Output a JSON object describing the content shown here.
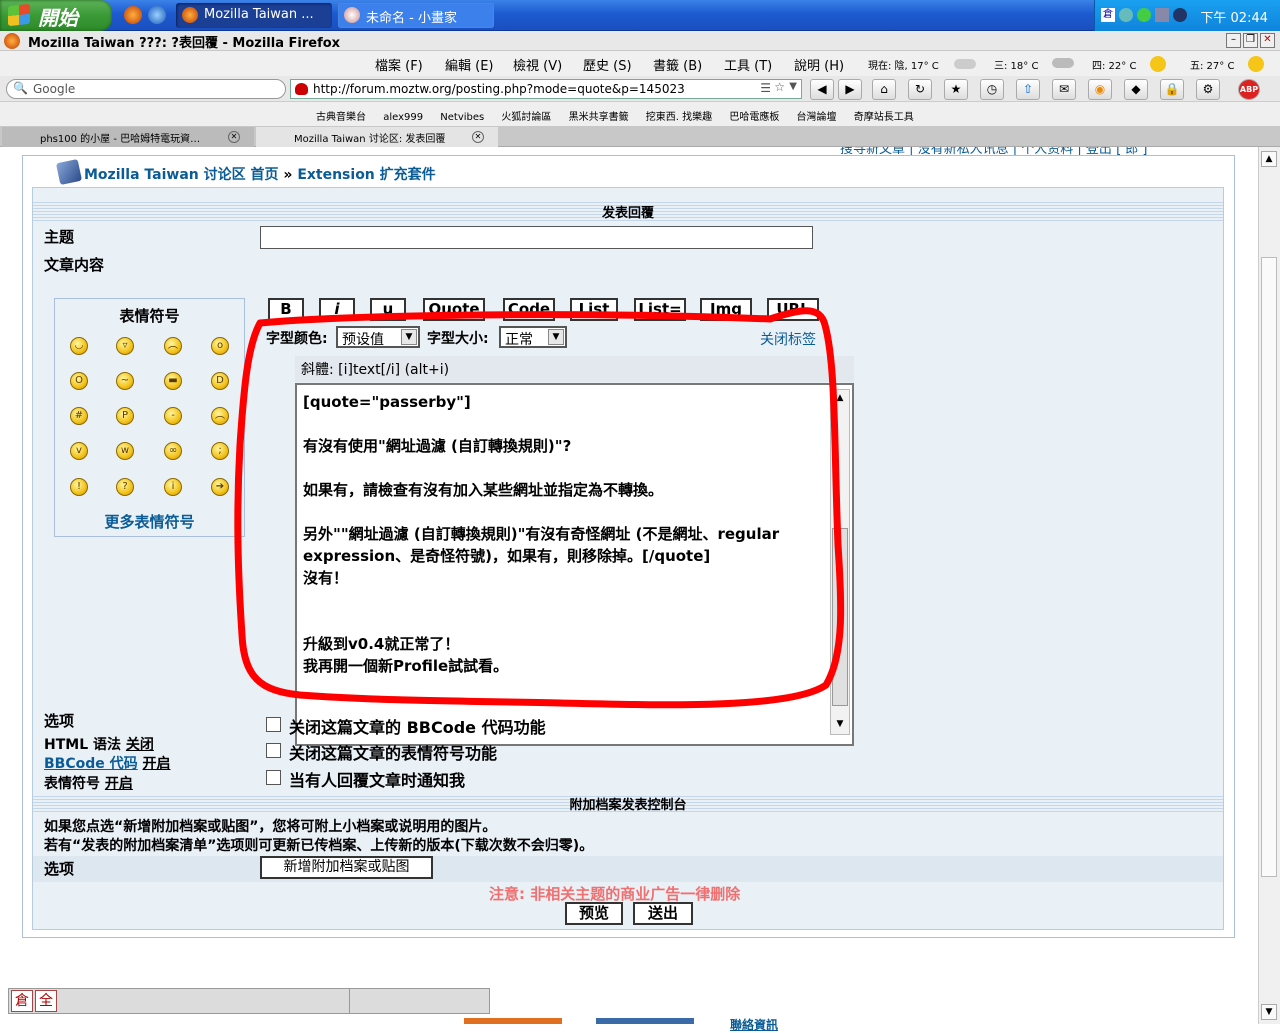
{
  "taskbar": {
    "start_label": "開始",
    "tasks": [
      {
        "label": "Mozilla Taiwan ...",
        "active": true
      },
      {
        "label": "未命名 - 小畫家",
        "active": false
      }
    ],
    "clock": "下午 02:44"
  },
  "window": {
    "title": "Mozilla Taiwan ???: ?表回覆 - Mozilla Firefox",
    "min": "–",
    "max": "❐",
    "close": "✕"
  },
  "menu": {
    "items": [
      "檔案 (F)",
      "編輯 (E)",
      "檢視 (V)",
      "歷史 (S)",
      "書籤 (B)",
      "工具 (T)",
      "說明 (H)"
    ],
    "weather": [
      "現在: 陰, 17° C",
      "三: 18° C",
      "四: 22° C",
      "五: 27° C"
    ]
  },
  "nav": {
    "search_placeholder": "Google",
    "url": "http://forum.moztw.org/posting.php?mode=quote&p=145023"
  },
  "bookmarks": [
    "古典音樂台",
    "alex999",
    "Netvibes",
    "火狐討論區",
    "黑米共享書籤",
    "挖東西. 找樂趣",
    "巴哈電應板",
    "台灣論壇",
    "奇摩站長工具"
  ],
  "tabs": [
    {
      "label": "phs100 的小屋 - 巴哈姆特電玩資…"
    },
    {
      "label": "Mozilla Taiwan 讨论区: 发表回覆"
    }
  ],
  "forum": {
    "toplinks": "搜寻新文章 | 没有新私人讯息 | 个人资料 | 登出 [ 郎 ]",
    "breadcrumb_home": "Mozilla Taiwan 讨论区 首页",
    "breadcrumb_sep": "»",
    "breadcrumb_section": "Extension 扩充套件",
    "post_header": "发表回覆",
    "subject_label": "主题",
    "content_label": "文章内容",
    "bbcode_buttons": [
      "B",
      "i",
      "u",
      "Quote",
      "Code",
      "List",
      "List=",
      "Img",
      "URL"
    ],
    "font_color_label": "字型颜色:",
    "font_color_value": "预设值",
    "font_size_label": "字型大小:",
    "font_size_value": "正常",
    "close_tags": "关闭标签",
    "smilies_title": "表情符号",
    "more_smilies": "更多表情符号",
    "help_line": "斜體: [i]text[/i]  (alt+i)",
    "message": "[quote=\"passerby\"]\n\n有沒有使用\"網址過濾 (自訂轉換規則)\"?\n\n如果有，請檢查有沒有加入某些網址並指定為不轉換。\n\n另外\"\"網址過濾 (自訂轉換規則)\"有沒有奇怪網址 (不是網址、regular expression、是奇怪符號)，如果有，則移除掉。[/quote]\n沒有！\n\n\n升級到v0.4就正常了！\n我再開一個新Profile試試看。",
    "options_label": "选项",
    "html_label": "HTML 语法",
    "html_value": "关闭",
    "bbcode_label": "BBCode 代码",
    "bbcode_value": "开启",
    "smilies_label": "表情符号",
    "smilies_value": "开启",
    "opt1": "关闭这篇文章的 BBCode 代码功能",
    "opt2": "关闭这篇文章的表情符号功能",
    "opt3": "当有人回覆文章时通知我",
    "attach_header": "附加档案发表控制台",
    "attach_line1": "如果您点选“新增附加档案或贴图”，您将可附上小档案或说明用的图片。",
    "attach_line2": "若有“发表的附加档案清单”选项则可更新已传档案、上传新的版本(下载次数不会归零)。",
    "attach_options_label": "选项",
    "attach_button": "新增附加档案或贴图",
    "notice": "注意: 非相关主题的商业广告一律删除",
    "preview_button": "预览",
    "submit_button": "送出"
  },
  "statusbar": {
    "ime1": "倉",
    "ime2": "全",
    "below_link": "聯絡資訊"
  },
  "colors": {
    "link": "#0b5c96",
    "notice": "#f07070",
    "highlight": "#ff0000"
  }
}
